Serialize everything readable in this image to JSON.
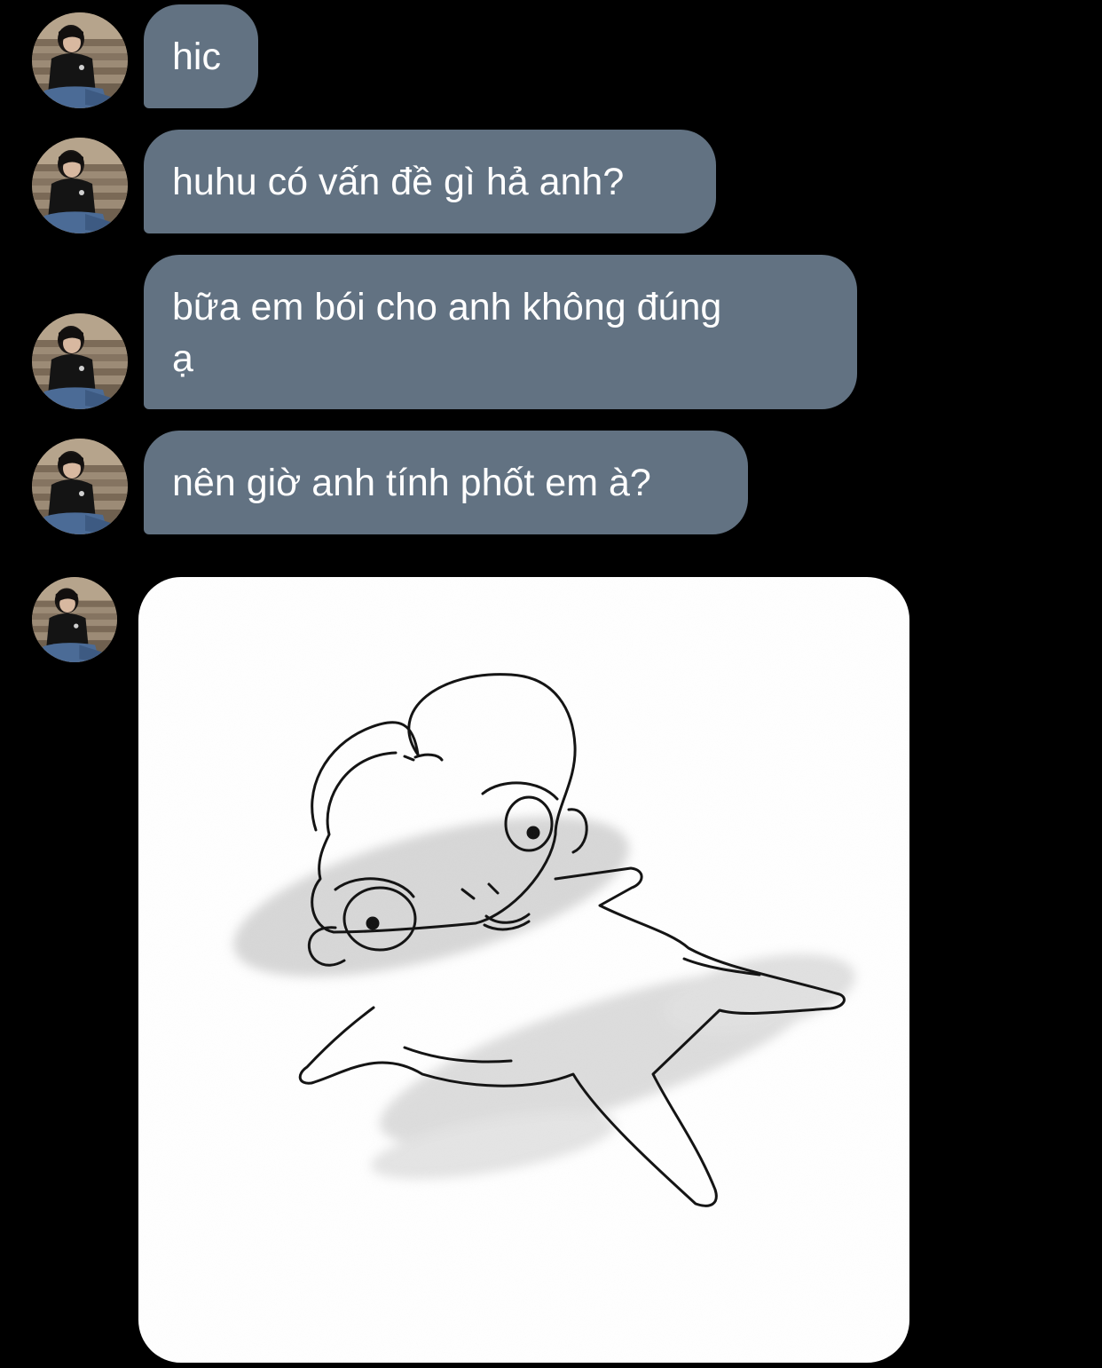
{
  "messages": [
    {
      "text": "hic"
    },
    {
      "text": "huhu có vấn đề gì hả anh?"
    },
    {
      "text_line1": "bữa em bói cho anh không đúng",
      "text_line2": "ạ"
    },
    {
      "text": "nên giờ anh tính phốt em à?"
    }
  ],
  "sticker": {
    "icon": "sad-drawn-character-sticker"
  },
  "colors": {
    "background": "#000000",
    "bubble": "#627282",
    "bubble_text": "#ffffff",
    "image_bg": "#ffffff"
  }
}
